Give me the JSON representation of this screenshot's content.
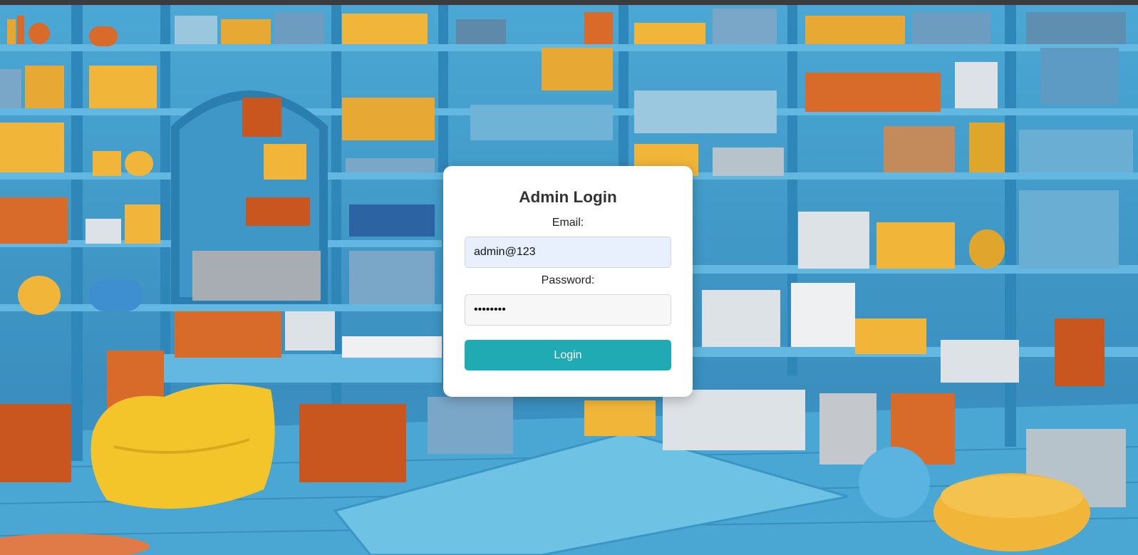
{
  "login": {
    "title": "Admin Login",
    "email_label": "Email:",
    "email_value": "admin@123",
    "password_label": "Password:",
    "password_value": "••••••••",
    "button_label": "Login"
  },
  "colors": {
    "button": "#20aab3",
    "email_field_bg": "#e8f0fe",
    "background_blue": "#3a9ac8"
  }
}
